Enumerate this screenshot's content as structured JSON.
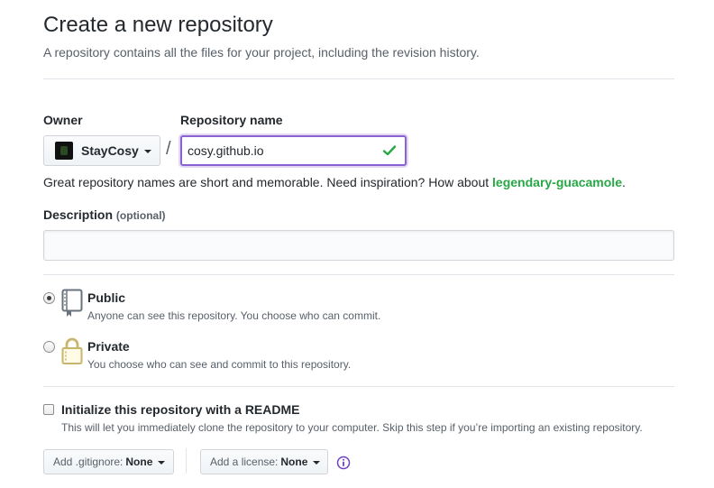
{
  "header": {
    "title": "Create a new repository",
    "subtitle": "A repository contains all the files for your project, including the revision history."
  },
  "owner": {
    "label": "Owner",
    "value": "StayCosy"
  },
  "separator": "/",
  "repo_name": {
    "label": "Repository name",
    "value": "cosy.github.io",
    "valid_icon": "check-icon"
  },
  "hint": {
    "text": "Great repository names are short and memorable. Need inspiration? How about ",
    "suggestion": "legendary-guacamole",
    "suffix": "."
  },
  "description": {
    "label": "Description",
    "optional": "(optional)",
    "value": ""
  },
  "visibility": {
    "selected": "public",
    "options": [
      {
        "id": "public",
        "title": "Public",
        "desc": "Anyone can see this repository. You choose who can commit.",
        "icon": "repo-book-icon"
      },
      {
        "id": "private",
        "title": "Private",
        "desc": "You choose who can see and commit to this repository.",
        "icon": "lock-icon"
      }
    ]
  },
  "readme": {
    "checked": false,
    "title": "Initialize this repository with a README",
    "desc": "This will let you immediately clone the repository to your computer. Skip this step if you’re importing an existing repository."
  },
  "gitignore": {
    "label": "Add .gitignore:",
    "value": "None"
  },
  "license": {
    "label": "Add a license:",
    "value": "None",
    "info_icon": "info-icon"
  },
  "colors": {
    "focus": "#8a63d2",
    "success": "#28a745",
    "info": "#6f42c1"
  }
}
